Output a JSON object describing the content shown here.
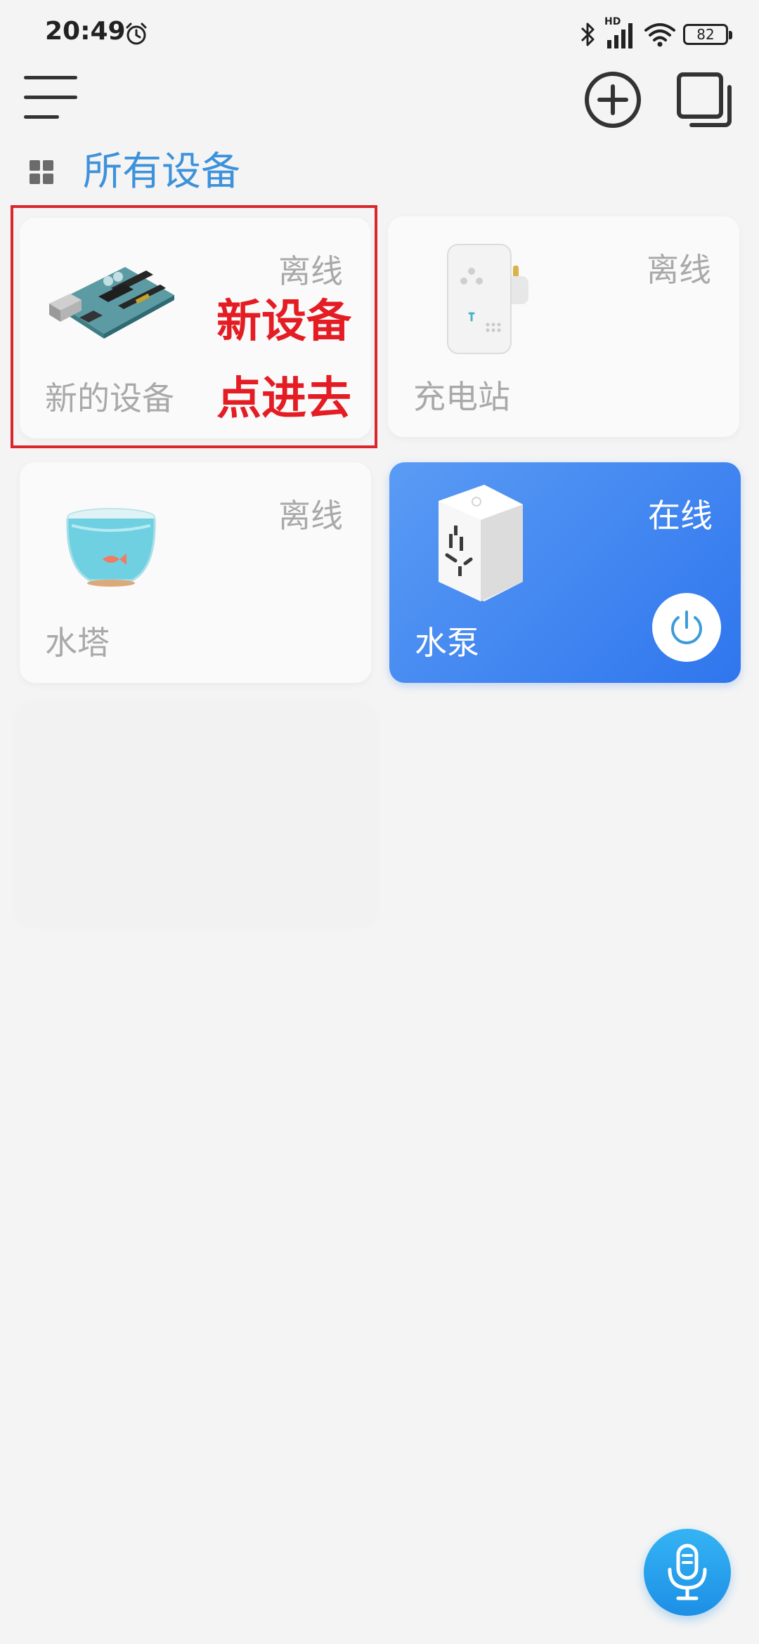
{
  "status_bar": {
    "time": "20:49",
    "battery": "82",
    "icons": [
      "alarm-icon",
      "bluetooth-icon",
      "signal-icon",
      "wifi-icon",
      "battery-icon"
    ],
    "network_badge": "HD"
  },
  "toolbar": {
    "menu_icon": "menu-icon",
    "add_icon": "add-circle-icon",
    "multi_icon": "multi-window-icon"
  },
  "section": {
    "title": "所有设备",
    "icon": "grid-icon"
  },
  "devices": [
    {
      "name": "新的设备",
      "status": "离线",
      "online": false,
      "image": "arduino-board"
    },
    {
      "name": "充电站",
      "status": "离线",
      "online": false,
      "image": "plug-adapter"
    },
    {
      "name": "水塔",
      "status": "离线",
      "online": false,
      "image": "fishbowl"
    },
    {
      "name": "水泵",
      "status": "在线",
      "online": true,
      "image": "smart-socket"
    }
  ],
  "annotation": {
    "line1": "新设备",
    "line2": "点进去",
    "color": "#e41d24"
  },
  "colors": {
    "accent": "#3d92db",
    "online_card": "#3d83f0",
    "offline_text": "#a9a9a9",
    "fab": "#1d8fe6"
  },
  "fab": {
    "icon": "microphone-icon"
  }
}
